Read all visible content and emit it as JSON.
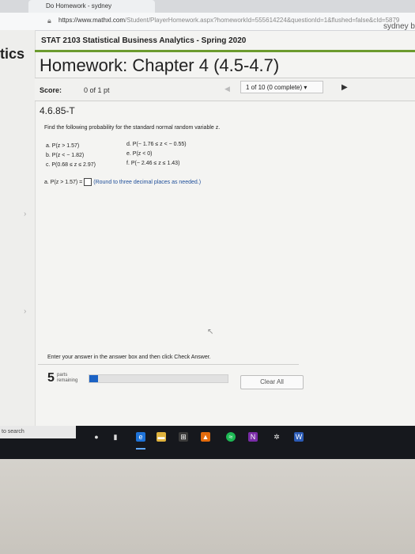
{
  "browser": {
    "tab_title": "Do Homework - sydney",
    "url_host": "https://www.mathxl.com",
    "url_path": "/Student/PlayerHomework.aspx?homeworkId=555614224&questionId=1&flushed=false&cId=5879"
  },
  "header": {
    "left_fragment": "tics",
    "course": "STAT 2103 Statistical Business Analytics - Spring 2020",
    "user": "sydney b",
    "title": "Homework: Chapter 4 (4.5-4.7)",
    "accent_color": "#6c9b2e"
  },
  "score_bar": {
    "score_label": "Score:",
    "score_value": "0 of 1 pt",
    "question_select": "1 of 10 (0 complete)"
  },
  "question": {
    "id": "4.6.85-T",
    "instructions": "Find the following probability for the standard normal random variable z.",
    "parts": [
      "a. P(z > 1.57)",
      "b. P(z < − 1.82)",
      "c. P(0.68 ≤ z ≤ 2.97)",
      "d. P(− 1.76 ≤ z < − 0.55)",
      "e. P(z < 0)",
      "f. P(− 2.46 ≤ z ≤ 1.43)"
    ],
    "answer_prompt": "a. P(z > 1.57) =",
    "answer_hint": "(Round to three decimal places as needed.)"
  },
  "footer": {
    "instruction": "Enter your answer in the answer box and then click Check Answer.",
    "parts_count": "5",
    "parts_label_1": "parts",
    "parts_label_2": "remaining",
    "progress_fraction": 0.06,
    "clear_all": "Clear All"
  },
  "taskbar": {
    "search_placeholder": "to search",
    "icons": [
      "mic-icon",
      "task-view-icon",
      "edge-icon",
      "files-icon",
      "store-icon",
      "vlc-icon",
      "spotify-icon",
      "onenote-icon",
      "settings-icon",
      "word-icon"
    ]
  }
}
